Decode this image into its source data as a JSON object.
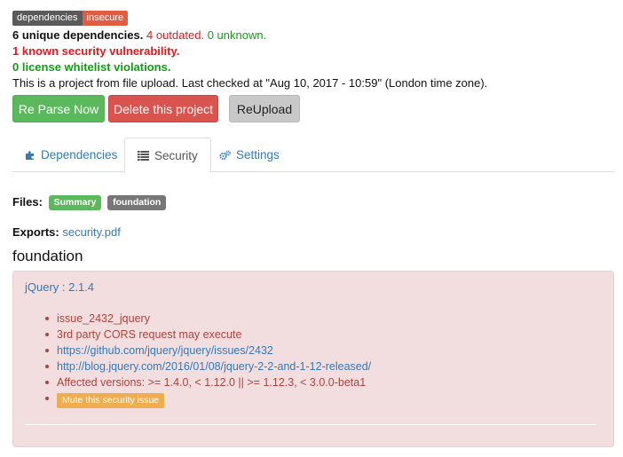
{
  "badge": {
    "left": "dependencies",
    "right": "insecure"
  },
  "summary": {
    "unique": "6 unique dependencies.",
    "outdated": "4 outdated.",
    "unknown": "0 unknown.",
    "vulnerabilities": "1 known security vulnerability.",
    "license": "0 license whitelist violations.",
    "project_info": "This is a project from file upload. Last checked at \"Aug 10, 2017 - 10:59\" (London time zone)."
  },
  "actions": {
    "reparse": "Re Parse Now",
    "delete": "Delete this project",
    "reupload": "ReUpload"
  },
  "tabs": [
    {
      "label": "Dependencies",
      "icon": "puzzle-icon"
    },
    {
      "label": "Security",
      "icon": "list-icon",
      "active": true
    },
    {
      "label": "Settings",
      "icon": "gears-icon"
    }
  ],
  "files": {
    "label": "Files:",
    "items": [
      "Summary",
      "foundation"
    ]
  },
  "exports": {
    "label": "Exports:",
    "file": "security.pdf"
  },
  "section_title": "foundation",
  "alert": {
    "title": "jQuery : 2.1.4",
    "items": [
      {
        "text": "issue_2432_jquery"
      },
      {
        "text": "3rd party CORS request may execute"
      },
      {
        "text": "https://github.com/jquery/jquery/issues/2432",
        "link": true
      },
      {
        "text": "http://blog.jquery.com/2016/01/08/jquery-2-2-and-1-12-released/",
        "link": true
      },
      {
        "text": "Affected versions: >= 1.4.0, < 1.12.0 || >= 1.12.3, < 3.0.0-beta1"
      }
    ],
    "mute": "Mute this security issue"
  }
}
